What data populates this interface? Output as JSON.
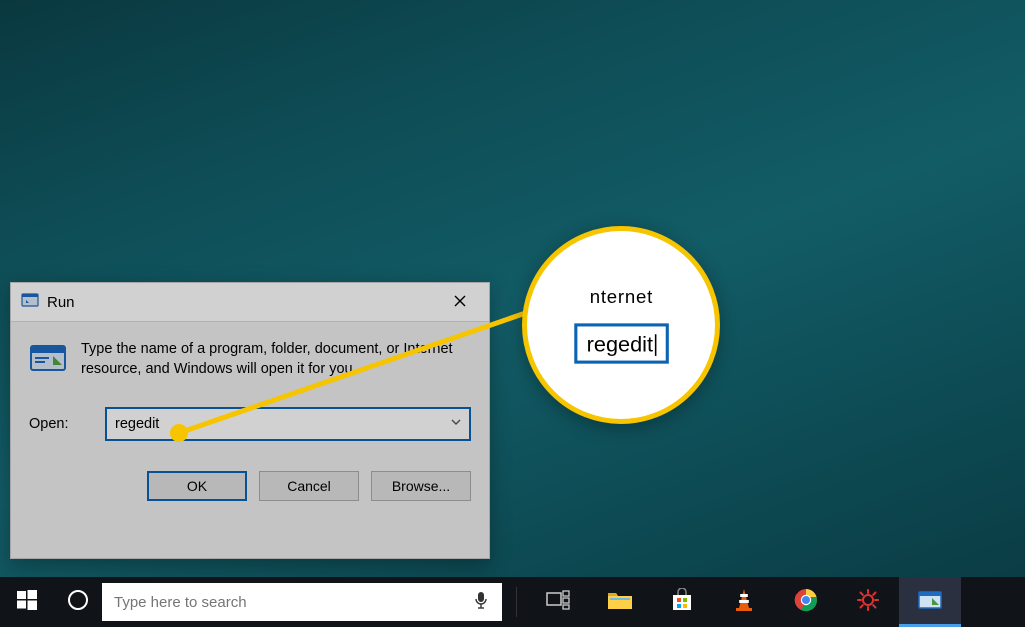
{
  "run_dialog": {
    "title": "Run",
    "message": "Type the name of a program, folder, document, or Internet resource, and Windows will open it for you.",
    "open_label": "Open:",
    "open_value": "regedit",
    "buttons": {
      "ok": "OK",
      "cancel": "Cancel",
      "browse": "Browse..."
    }
  },
  "callout": {
    "fragment_top": "nternet",
    "value": "regedit"
  },
  "taskbar": {
    "search_placeholder": "Type here to search"
  }
}
